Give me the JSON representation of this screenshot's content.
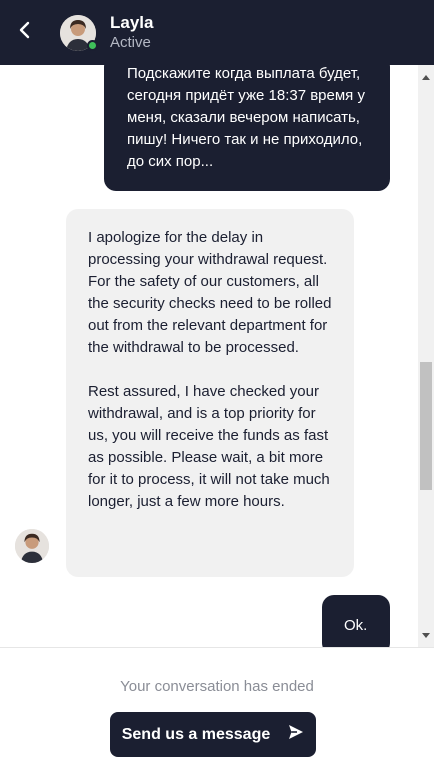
{
  "header": {
    "agent_name": "Layla",
    "agent_status": "Active",
    "status_color": "#3fbf5a",
    "background": "#1b1f31"
  },
  "messages": [
    {
      "direction": "outgoing",
      "text": "Подскажите когда выплата будет, сегодня придёт уже 18:37 время у меня, сказали вечером написать, пишу! Ничего так и не приходило, до сих пор..."
    },
    {
      "direction": "incoming",
      "text": "I apologize for the delay in processing your withdrawal request. For the safety of our customers, all the security checks need to be rolled out from the relevant department for the withdrawal to be processed.\n\nRest assured, I have checked your withdrawal, and is a top priority for us, you will receive the funds as fast as possible. Please wait, a bit more for it to process, it will not take much longer, just a few more hours."
    },
    {
      "direction": "outgoing",
      "text": "Ok."
    }
  ],
  "footer": {
    "ended_text": "Your conversation has ended",
    "send_button_label": "Send us a message"
  }
}
